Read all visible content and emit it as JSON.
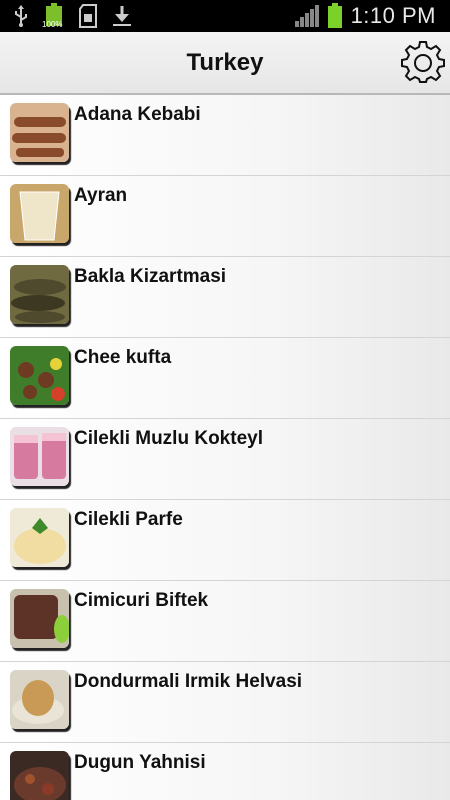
{
  "status_bar": {
    "time": "1:10 PM",
    "battery_label": "100%",
    "icons": [
      "usb-icon",
      "battery-full-icon",
      "sd-card-icon",
      "download-icon",
      "signal-icon",
      "battery-icon"
    ]
  },
  "app_bar": {
    "title": "Turkey",
    "settings_icon": "gear-icon"
  },
  "recipes": [
    {
      "name": "Adana Kebabi",
      "thumb_color": "#8a4a2c"
    },
    {
      "name": "Ayran",
      "thumb_color": "#efe6c9"
    },
    {
      "name": "Bakla Kizartmasi",
      "thumb_color": "#4f4a2e"
    },
    {
      "name": "Chee kufta",
      "thumb_color": "#6e3a22"
    },
    {
      "name": "Cilekli Muzlu Kokteyl",
      "thumb_color": "#d77aa0"
    },
    {
      "name": "Cilekli Parfe",
      "thumb_color": "#f1dca2"
    },
    {
      "name": "Cimicuri Biftek",
      "thumb_color": "#5c3326"
    },
    {
      "name": "Dondurmali Irmik Helvasi",
      "thumb_color": "#c89a55"
    },
    {
      "name": "Dugun Yahnisi",
      "thumb_color": "#6a3b2c"
    }
  ]
}
